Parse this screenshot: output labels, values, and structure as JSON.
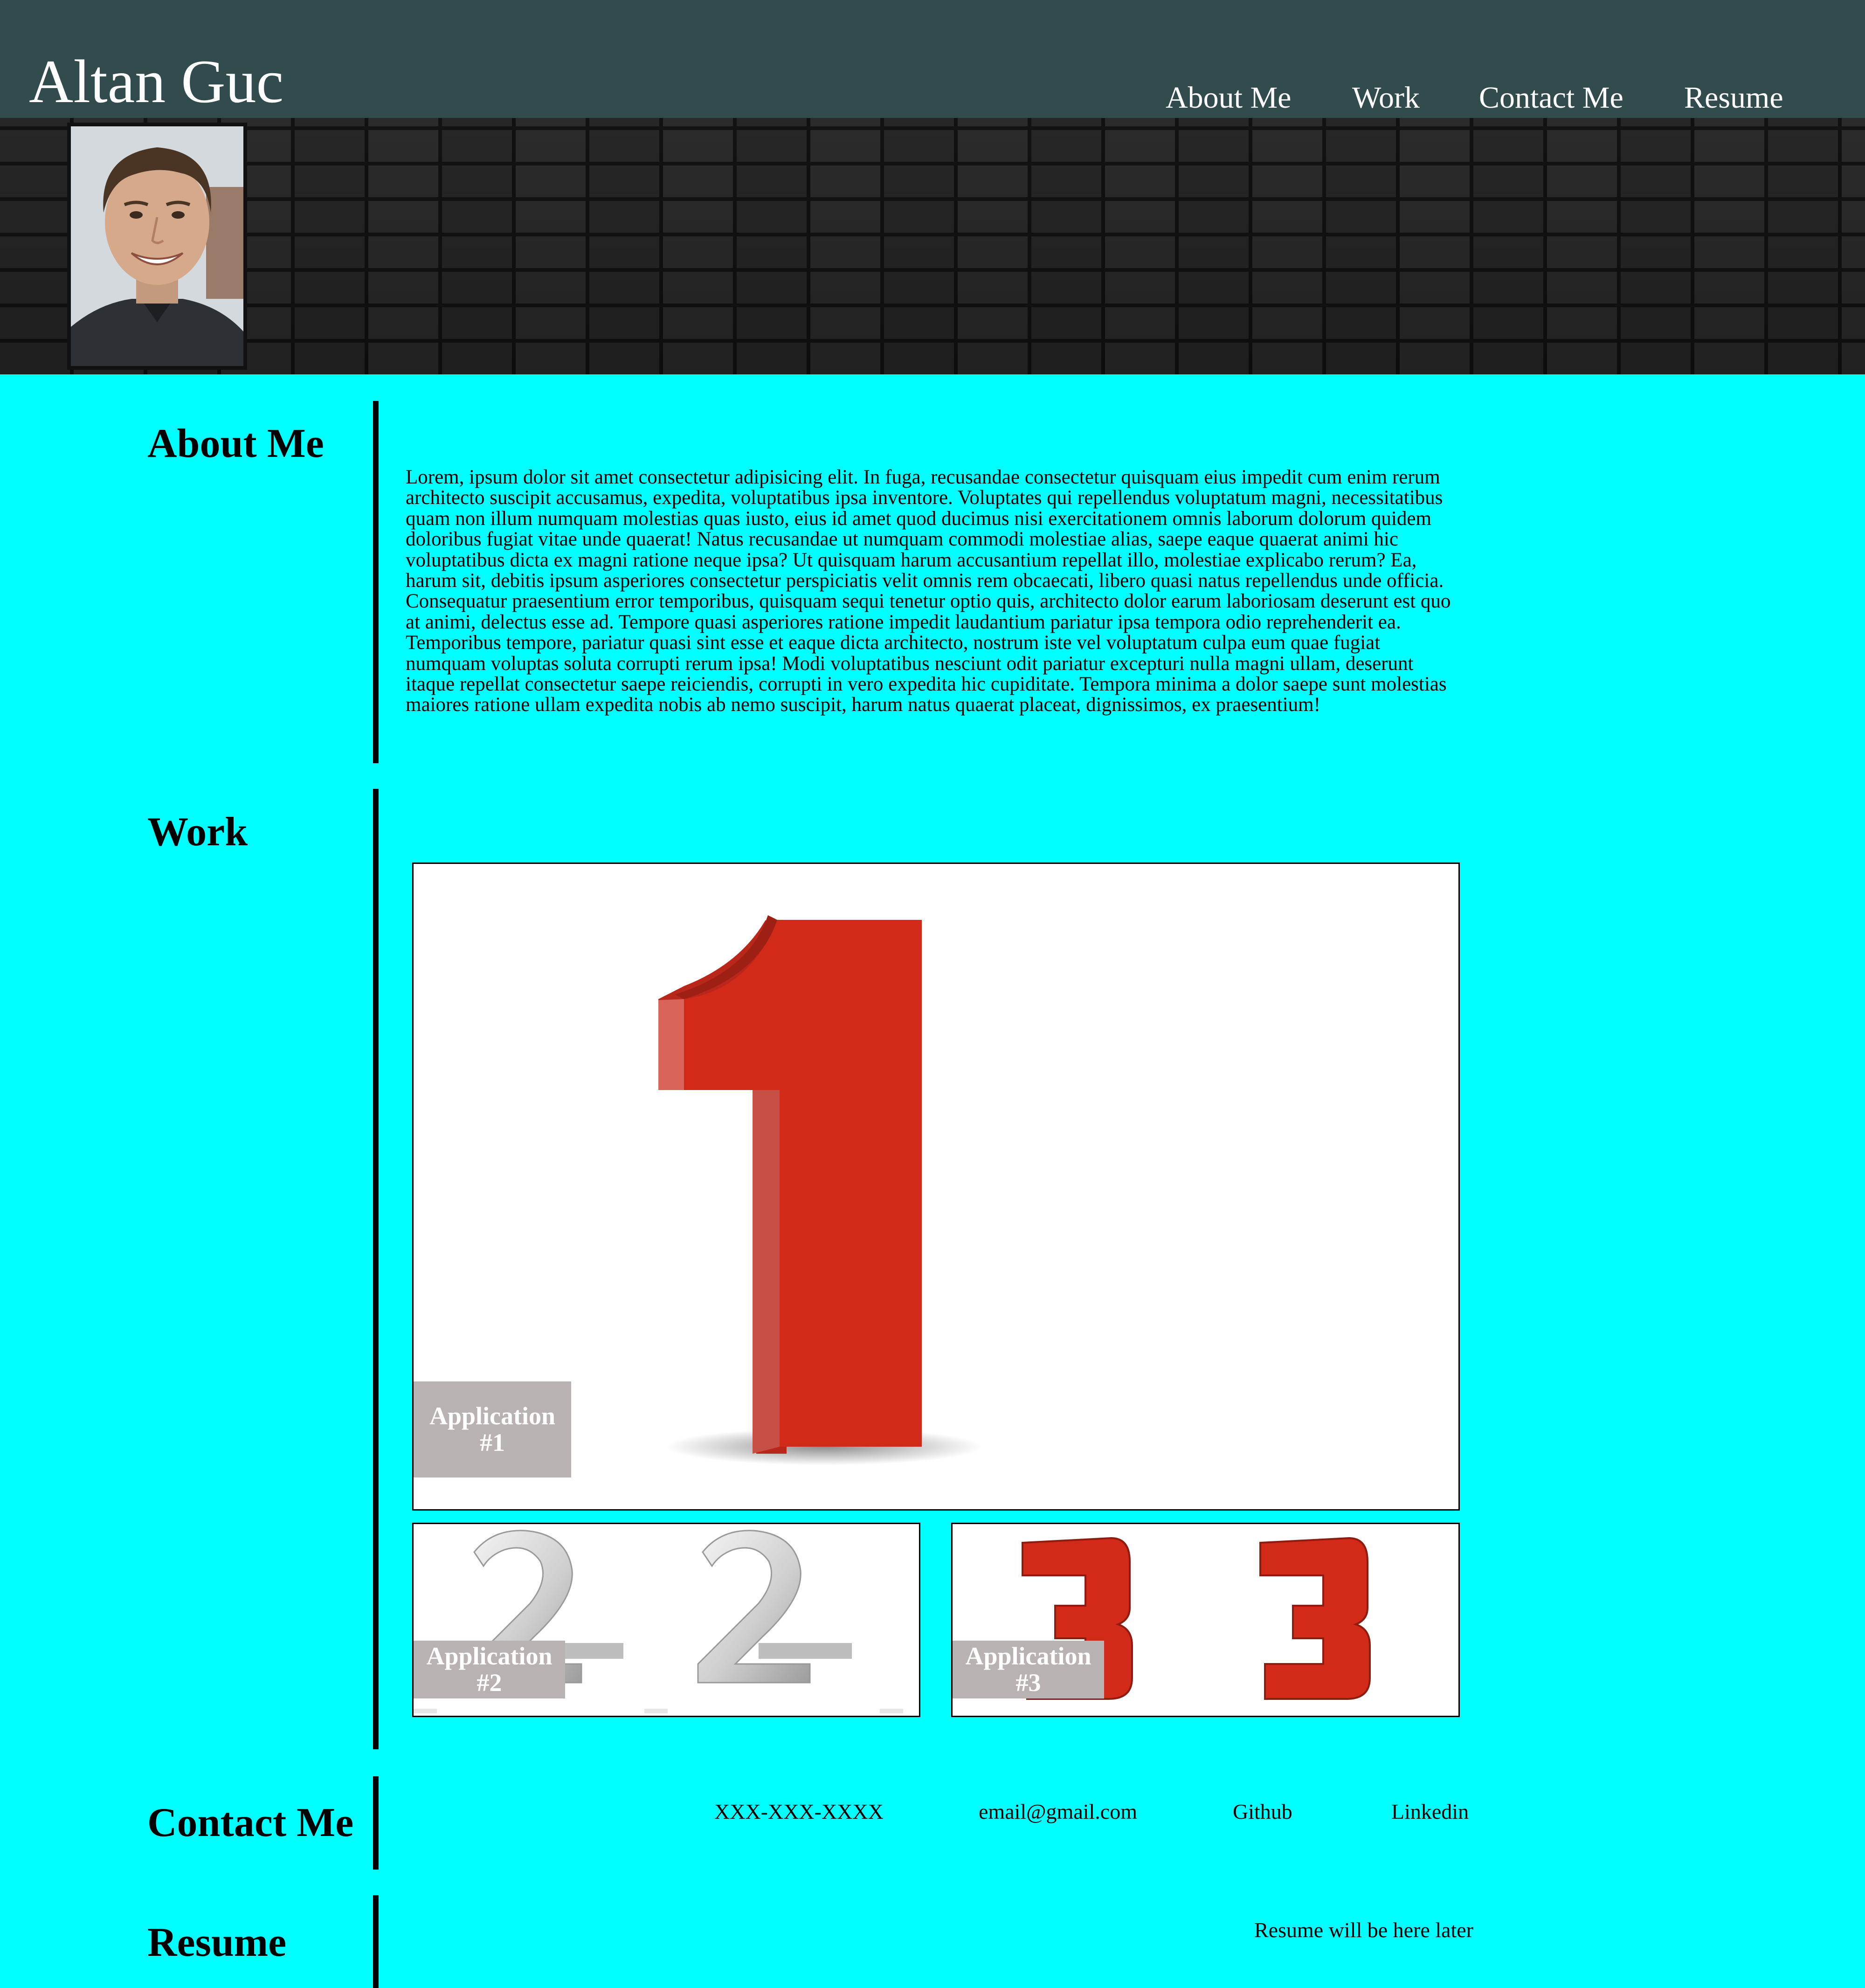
{
  "header": {
    "site_title": "Altan Guc",
    "nav": [
      "About Me",
      "Work",
      "Contact Me",
      "Resume"
    ]
  },
  "colors": {
    "page_background": "#00ffff",
    "header_background": "#324b4c",
    "label_background": "#b9b2b2",
    "numeral_red": "#d22a18"
  },
  "about": {
    "heading": "About Me",
    "text": "Lorem, ipsum dolor sit amet consectetur adipisicing elit. In fuga, recusandae consectetur quisquam eius impedit cum enim rerum architecto suscipit accusamus, expedita, voluptatibus ipsa inventore. Voluptates qui repellendus voluptatum magni, necessitatibus quam non illum numquam molestias quas iusto, eius id amet quod ducimus nisi exercitationem omnis laborum dolorum quidem doloribus fugiat vitae unde quaerat! Natus recusandae ut numquam commodi molestiae alias, saepe eaque quaerat animi hic voluptatibus dicta ex magni ratione neque ipsa? Ut quisquam harum accusantium repellat illo, molestiae explicabo rerum? Ea, harum sit, debitis ipsum asperiores consectetur perspiciatis velit omnis rem obcaecati, libero quasi natus repellendus unde officia. Consequatur praesentium error temporibus, quisquam sequi tenetur optio quis, architecto dolor earum laboriosam deserunt est quo at animi, delectus esse ad. Tempore quasi asperiores ratione impedit laudantium pariatur ipsa tempora odio reprehenderit ea. Temporibus tempore, pariatur quasi sint esse et eaque dicta architecto, nostrum iste vel voluptatum culpa eum quae fugiat numquam voluptas soluta corrupti rerum ipsa! Modi voluptatibus nesciunt odit pariatur excepturi nulla magni ullam, deserunt itaque repellat consectetur saepe reiciendis, corrupti in vero expedita hic cupiditate. Tempora minima a dolor saepe sunt molestias maiores ratione ullam expedita nobis ab nemo suscipit, harum natus quaerat placeat, dignissimos, ex praesentium!"
  },
  "work": {
    "heading": "Work",
    "apps": [
      {
        "label_line1": "Application",
        "label_line2": "#1",
        "numeral": "1"
      },
      {
        "label_line1": "Application",
        "label_line2": "#2",
        "numeral": "2"
      },
      {
        "label_line1": "Application",
        "label_line2": "#3",
        "numeral": "3"
      }
    ]
  },
  "contact": {
    "heading": "Contact Me",
    "phone": "XXX-XXX-XXXX",
    "email": "email@gmail.com",
    "github": "Github",
    "linkedin": "Linkedin"
  },
  "resume": {
    "heading": "Resume",
    "note": "Resume will be here later"
  }
}
